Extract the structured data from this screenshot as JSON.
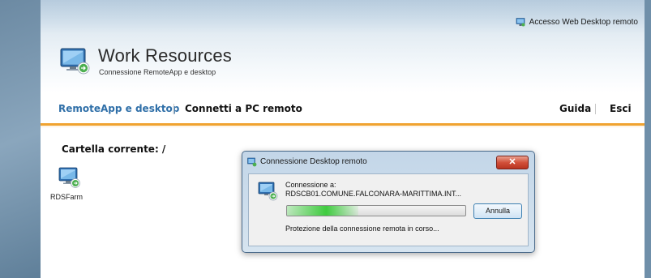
{
  "header": {
    "web_access_link": "Accesso Web Desktop remoto",
    "title": "Work Resources",
    "subtitle": "Connessione RemoteApp e desktop"
  },
  "nav": {
    "left_tabs": [
      {
        "label": "RemoteApp e desktop",
        "active": true
      },
      {
        "label": "Connetti a PC remoto",
        "active": false
      }
    ],
    "right_links": [
      {
        "label": "Guida"
      },
      {
        "label": "Esci"
      }
    ]
  },
  "main": {
    "current_folder": "Cartella corrente: /",
    "apps": [
      {
        "label": "RDSFarm",
        "icon": "remote-desktop-icon"
      }
    ]
  },
  "dialog": {
    "title": "Connessione Desktop remoto",
    "connecting_to_label": "Connessione a:",
    "server": "RDSCB01.COMUNE.FALCONARA-MARITTIMA.INT...",
    "progress": 0.4,
    "cancel_label": "Annulla",
    "status": "Protezione della connessione remota in corso...",
    "close_glyph": "✕"
  },
  "colors": {
    "accent_orange": "#f0a330",
    "active_tab_blue": "#2f6fa8",
    "progress_green": "#3fcb3f"
  }
}
